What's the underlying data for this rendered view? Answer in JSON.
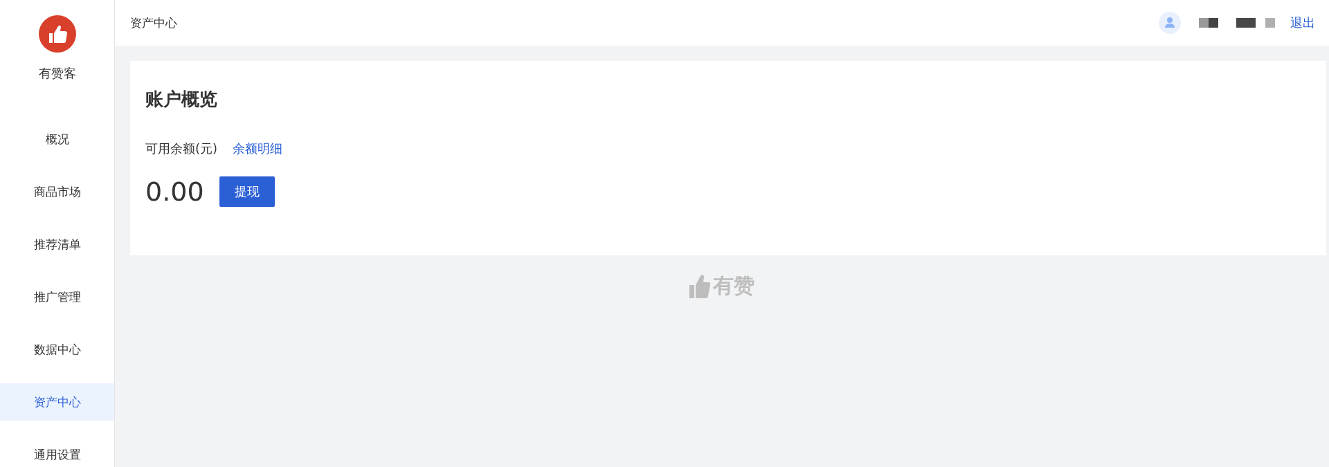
{
  "brand": {
    "name": "有赞客"
  },
  "sidebar": {
    "items": [
      {
        "label": "概况",
        "selected": false
      },
      {
        "label": "商品市场",
        "selected": false
      },
      {
        "label": "推荐清单",
        "selected": false
      },
      {
        "label": "推广管理",
        "selected": false
      },
      {
        "label": "数据中心",
        "selected": false
      },
      {
        "label": "资产中心",
        "selected": true
      },
      {
        "label": "通用设置",
        "selected": false
      }
    ]
  },
  "header": {
    "title": "资产中心",
    "logout": "退出"
  },
  "account": {
    "title": "账户概览",
    "balance_label": "可用余额(元)",
    "detail_link": "余额明细",
    "balance": "0.00",
    "withdraw_button": "提现"
  },
  "footer": {
    "brand": "有赞"
  }
}
